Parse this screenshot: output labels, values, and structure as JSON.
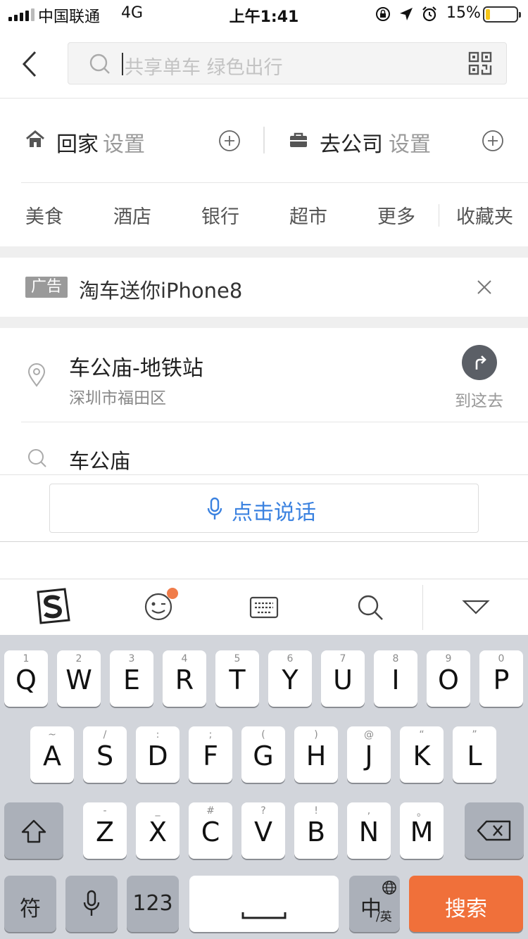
{
  "status_bar": {
    "carrier": "中国联通",
    "network": "4G",
    "time": "上午1:41",
    "battery_pct": "15%",
    "battery_level": 0.15,
    "icons": [
      "orientation-lock-icon",
      "location-arrow-icon",
      "alarm-icon"
    ]
  },
  "header": {
    "back_icon": "chevron-left-icon",
    "search_placeholder": "共享单车 绿色出行",
    "qr_icon": "qr-code-icon"
  },
  "quick": {
    "home_label": "回家",
    "home_action": "设置",
    "work_label": "去公司",
    "work_action": "设置"
  },
  "categories": [
    "美食",
    "酒店",
    "银行",
    "超市",
    "更多",
    "收藏夹"
  ],
  "ad": {
    "tag": "广告",
    "text": "淘车送你iPhone8"
  },
  "result": {
    "name": "车公庙-地铁站",
    "address": "深圳市福田区",
    "go_label": "到这去"
  },
  "history": {
    "text": "车公庙"
  },
  "voice": {
    "label": "点击说话"
  },
  "keyboard": {
    "row1": [
      {
        "k": "Q",
        "s": "1"
      },
      {
        "k": "W",
        "s": "2"
      },
      {
        "k": "E",
        "s": "3"
      },
      {
        "k": "R",
        "s": "4"
      },
      {
        "k": "T",
        "s": "5"
      },
      {
        "k": "Y",
        "s": "6"
      },
      {
        "k": "U",
        "s": "7"
      },
      {
        "k": "I",
        "s": "8"
      },
      {
        "k": "O",
        "s": "9"
      },
      {
        "k": "P",
        "s": "0"
      }
    ],
    "row2": [
      {
        "k": "A",
        "s": "~"
      },
      {
        "k": "S",
        "s": "/"
      },
      {
        "k": "D",
        "s": ":"
      },
      {
        "k": "F",
        "s": ";"
      },
      {
        "k": "G",
        "s": "("
      },
      {
        "k": "H",
        "s": ")"
      },
      {
        "k": "J",
        "s": "@"
      },
      {
        "k": "K",
        "s": "“"
      },
      {
        "k": "L",
        "s": "”"
      }
    ],
    "row3": [
      {
        "k": "Z",
        "s": "-"
      },
      {
        "k": "X",
        "s": "_"
      },
      {
        "k": "C",
        "s": "#"
      },
      {
        "k": "V",
        "s": "?"
      },
      {
        "k": "B",
        "s": "!"
      },
      {
        "k": "N",
        "s": ","
      },
      {
        "k": "M",
        "s": "。"
      }
    ],
    "symbols_key": "符",
    "numbers_key": "123",
    "lang_key_main": "中",
    "lang_key_sub": "/英",
    "search_key": "搜索",
    "accent_color": "#f0703a"
  }
}
